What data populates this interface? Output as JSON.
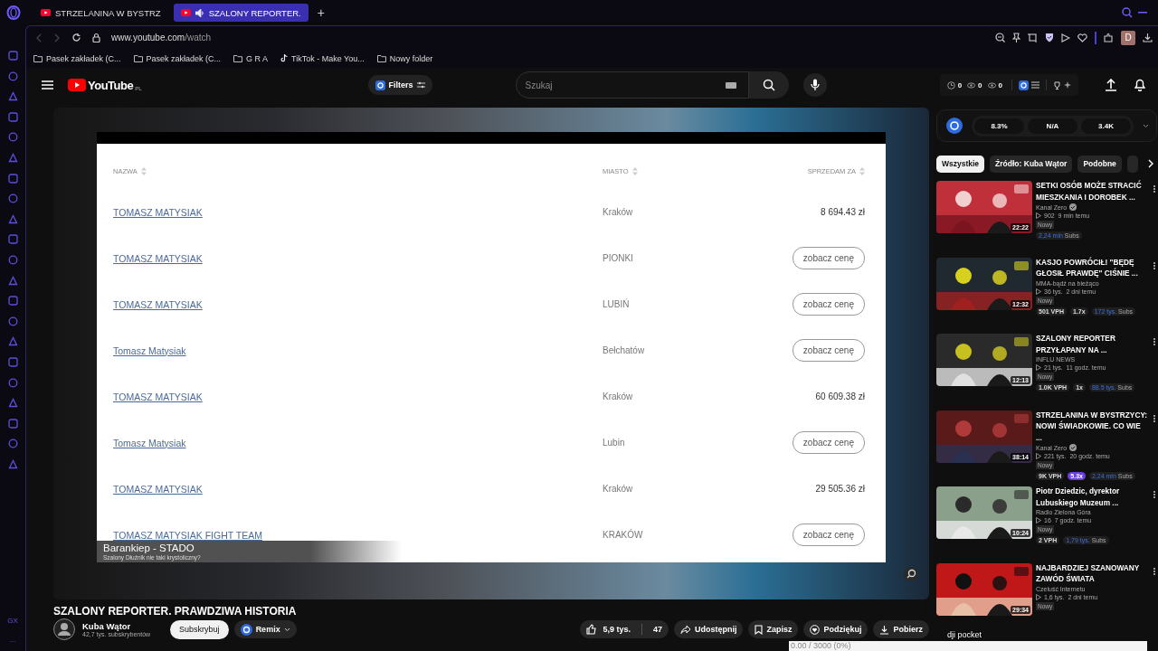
{
  "browser": {
    "tabs": [
      {
        "title": "STRZELANINA W BYSTRZ",
        "selected": false,
        "audio": false
      },
      {
        "title": "SZALONY REPORTER.",
        "selected": true,
        "audio": true
      }
    ],
    "new_tab": "+",
    "address": {
      "host": "www.youtube.com",
      "path": "/watch"
    },
    "bookmarks": [
      {
        "label": "Pasek zakładek (C...",
        "kind": "folder"
      },
      {
        "label": "Pasek zakładek (C...",
        "kind": "folder"
      },
      {
        "label": "G R A",
        "kind": "folder"
      },
      {
        "label": "TikTok - Make You...",
        "kind": "tiktok"
      },
      {
        "label": "Nowy folder",
        "kind": "folder"
      }
    ],
    "profile": "D",
    "sidebar_label": "GX",
    "sidebar_more": "..."
  },
  "youtube": {
    "logo": "YouTube",
    "region": "PL",
    "filters": "Filters",
    "search": {
      "placeholder": "Szukaj"
    },
    "counters": [
      "0",
      "0",
      "0"
    ]
  },
  "player": {
    "columns": [
      "NAZWA",
      "MIASTO",
      "SPRZEDAM ZA"
    ],
    "rows": [
      {
        "name": "TOMASZ MATYSIAK",
        "city": "Kraków",
        "kind": "price",
        "value": "8 694.43 zł"
      },
      {
        "name": "TOMASZ MATYSIAK",
        "city": "PIONKI",
        "kind": "button",
        "value": "zobacz cenę"
      },
      {
        "name": "TOMASZ MATYSIAK",
        "city": "LUBIŃ",
        "kind": "button",
        "value": "zobacz cenę"
      },
      {
        "name": "Tomasz Matysiak",
        "city": "Bełchatów",
        "kind": "button",
        "value": "zobacz cenę"
      },
      {
        "name": "TOMASZ MATYSIAK",
        "city": "Kraków",
        "kind": "price",
        "value": "60 609.38 zł"
      },
      {
        "name": "Tomasz Matysiak",
        "city": "Lubin",
        "kind": "button",
        "value": "zobacz cenę"
      },
      {
        "name": "TOMASZ MATYSIAK",
        "city": "Kraków",
        "kind": "price",
        "value": "29 505.36 zł"
      },
      {
        "name": "TOMASZ MATYSIAK FIGHT TEAM",
        "city": "KRAKÓW",
        "kind": "button",
        "value": "zobacz cenę"
      }
    ],
    "caption": {
      "title": "Barankiep - STADO",
      "subtitle": "Szalony Dłużnik nie taki krystoliczny?"
    }
  },
  "video": {
    "title": "SZALONY REPORTER. PRAWDZIWA HISTORIA",
    "channel": "Kuba Wątor",
    "subscribers": "42,7 tys. subskrybentów",
    "subscribe": "Subskrybuj",
    "remix": "Remix",
    "likes": "5,9 tys.",
    "dislikes": "47",
    "actions": [
      {
        "kind": "share",
        "label": "Udostępnij"
      },
      {
        "kind": "save",
        "label": "Zapisz"
      },
      {
        "kind": "thanks",
        "label": "Podziękuj"
      },
      {
        "kind": "download",
        "label": "Pobierz"
      }
    ]
  },
  "recorder": {
    "label": "dji pocket",
    "reading": "0.00 / 3000 (0%)"
  },
  "sidebar": {
    "stats": [
      "8.3%",
      "N/A",
      "3.4K"
    ],
    "chips": [
      {
        "label": "Wszystkie",
        "selected": true
      },
      {
        "label": "Źródło: Kuba Wątor",
        "selected": false
      },
      {
        "label": "Podobne",
        "selected": false
      }
    ],
    "videos": [
      {
        "title": "SETKI OSÓB MOŻE STRACIĆ MIESZKANIA I DOROBEK ...",
        "channel": "Kanal Zero",
        "verified": true,
        "views": "902",
        "age": "9 min temu",
        "badge": "Nowy",
        "duration": "22:22",
        "subs": "2,24 mln",
        "subs_unit": "Subs"
      },
      {
        "title": "KASJO POWRÓCIŁ! \"BĘDĘ GŁOSIŁ PRAWDĘ\" CIŚNIE ...",
        "channel": "MMA-bądź na bieżąco",
        "verified": false,
        "views": "36 tys.",
        "age": "2 dni temu",
        "badge": "Nowy",
        "duration": "12:32",
        "stats": [
          {
            "text": "501 VPH",
            "highlighted": false
          },
          {
            "text": "1.7x",
            "highlighted": false
          }
        ],
        "subs": "172 tys.",
        "subs_unit": "Subs"
      },
      {
        "title": "SZALONY REPORTER PRZYŁAPANY NA ...",
        "channel": "INFLU NEWS",
        "verified": false,
        "views": "21 tys.",
        "age": "11 godz. temu",
        "badge": "Nowy",
        "duration": "12:13",
        "stats": [
          {
            "text": "1.0K VPH",
            "highlighted": false
          },
          {
            "text": "1x",
            "highlighted": false
          }
        ],
        "subs": "88.5 tys.",
        "subs_unit": "Subs"
      },
      {
        "title": "STRZELANINA W BYSTRZYCY: NOWI ŚWIADKOWIE. CO WIE ...",
        "channel": "Kanal Zero",
        "verified": true,
        "views": "221 tys.",
        "age": "20 godz. temu",
        "badge": "Nowy",
        "duration": "38:14",
        "stats": [
          {
            "text": "9K VPH",
            "highlighted": false
          },
          {
            "text": "5.3x",
            "highlighted": true
          }
        ],
        "subs": "2,24 mln",
        "subs_unit": "Subs"
      },
      {
        "title": "Piotr Dziedzic, dyrektor Lubuskiego Muzeum ...",
        "channel": "Radio Zielona Góra",
        "verified": false,
        "views": "16",
        "age": "7 godz. temu",
        "badge": "Nowy",
        "duration": "10:24",
        "stats": [
          {
            "text": "2 VPH",
            "highlighted": false
          }
        ],
        "subs": "1,79 tys.",
        "subs_unit": "Subs"
      },
      {
        "title": "NAJBARDZIEJ SZANOWANY ZAWÓD ŚWIATA",
        "channel": "Czeluść Internetu",
        "verified": false,
        "views": "1,6 tys.",
        "age": "2 dni temu",
        "badge": "Nowy",
        "duration": "29:34"
      }
    ]
  }
}
